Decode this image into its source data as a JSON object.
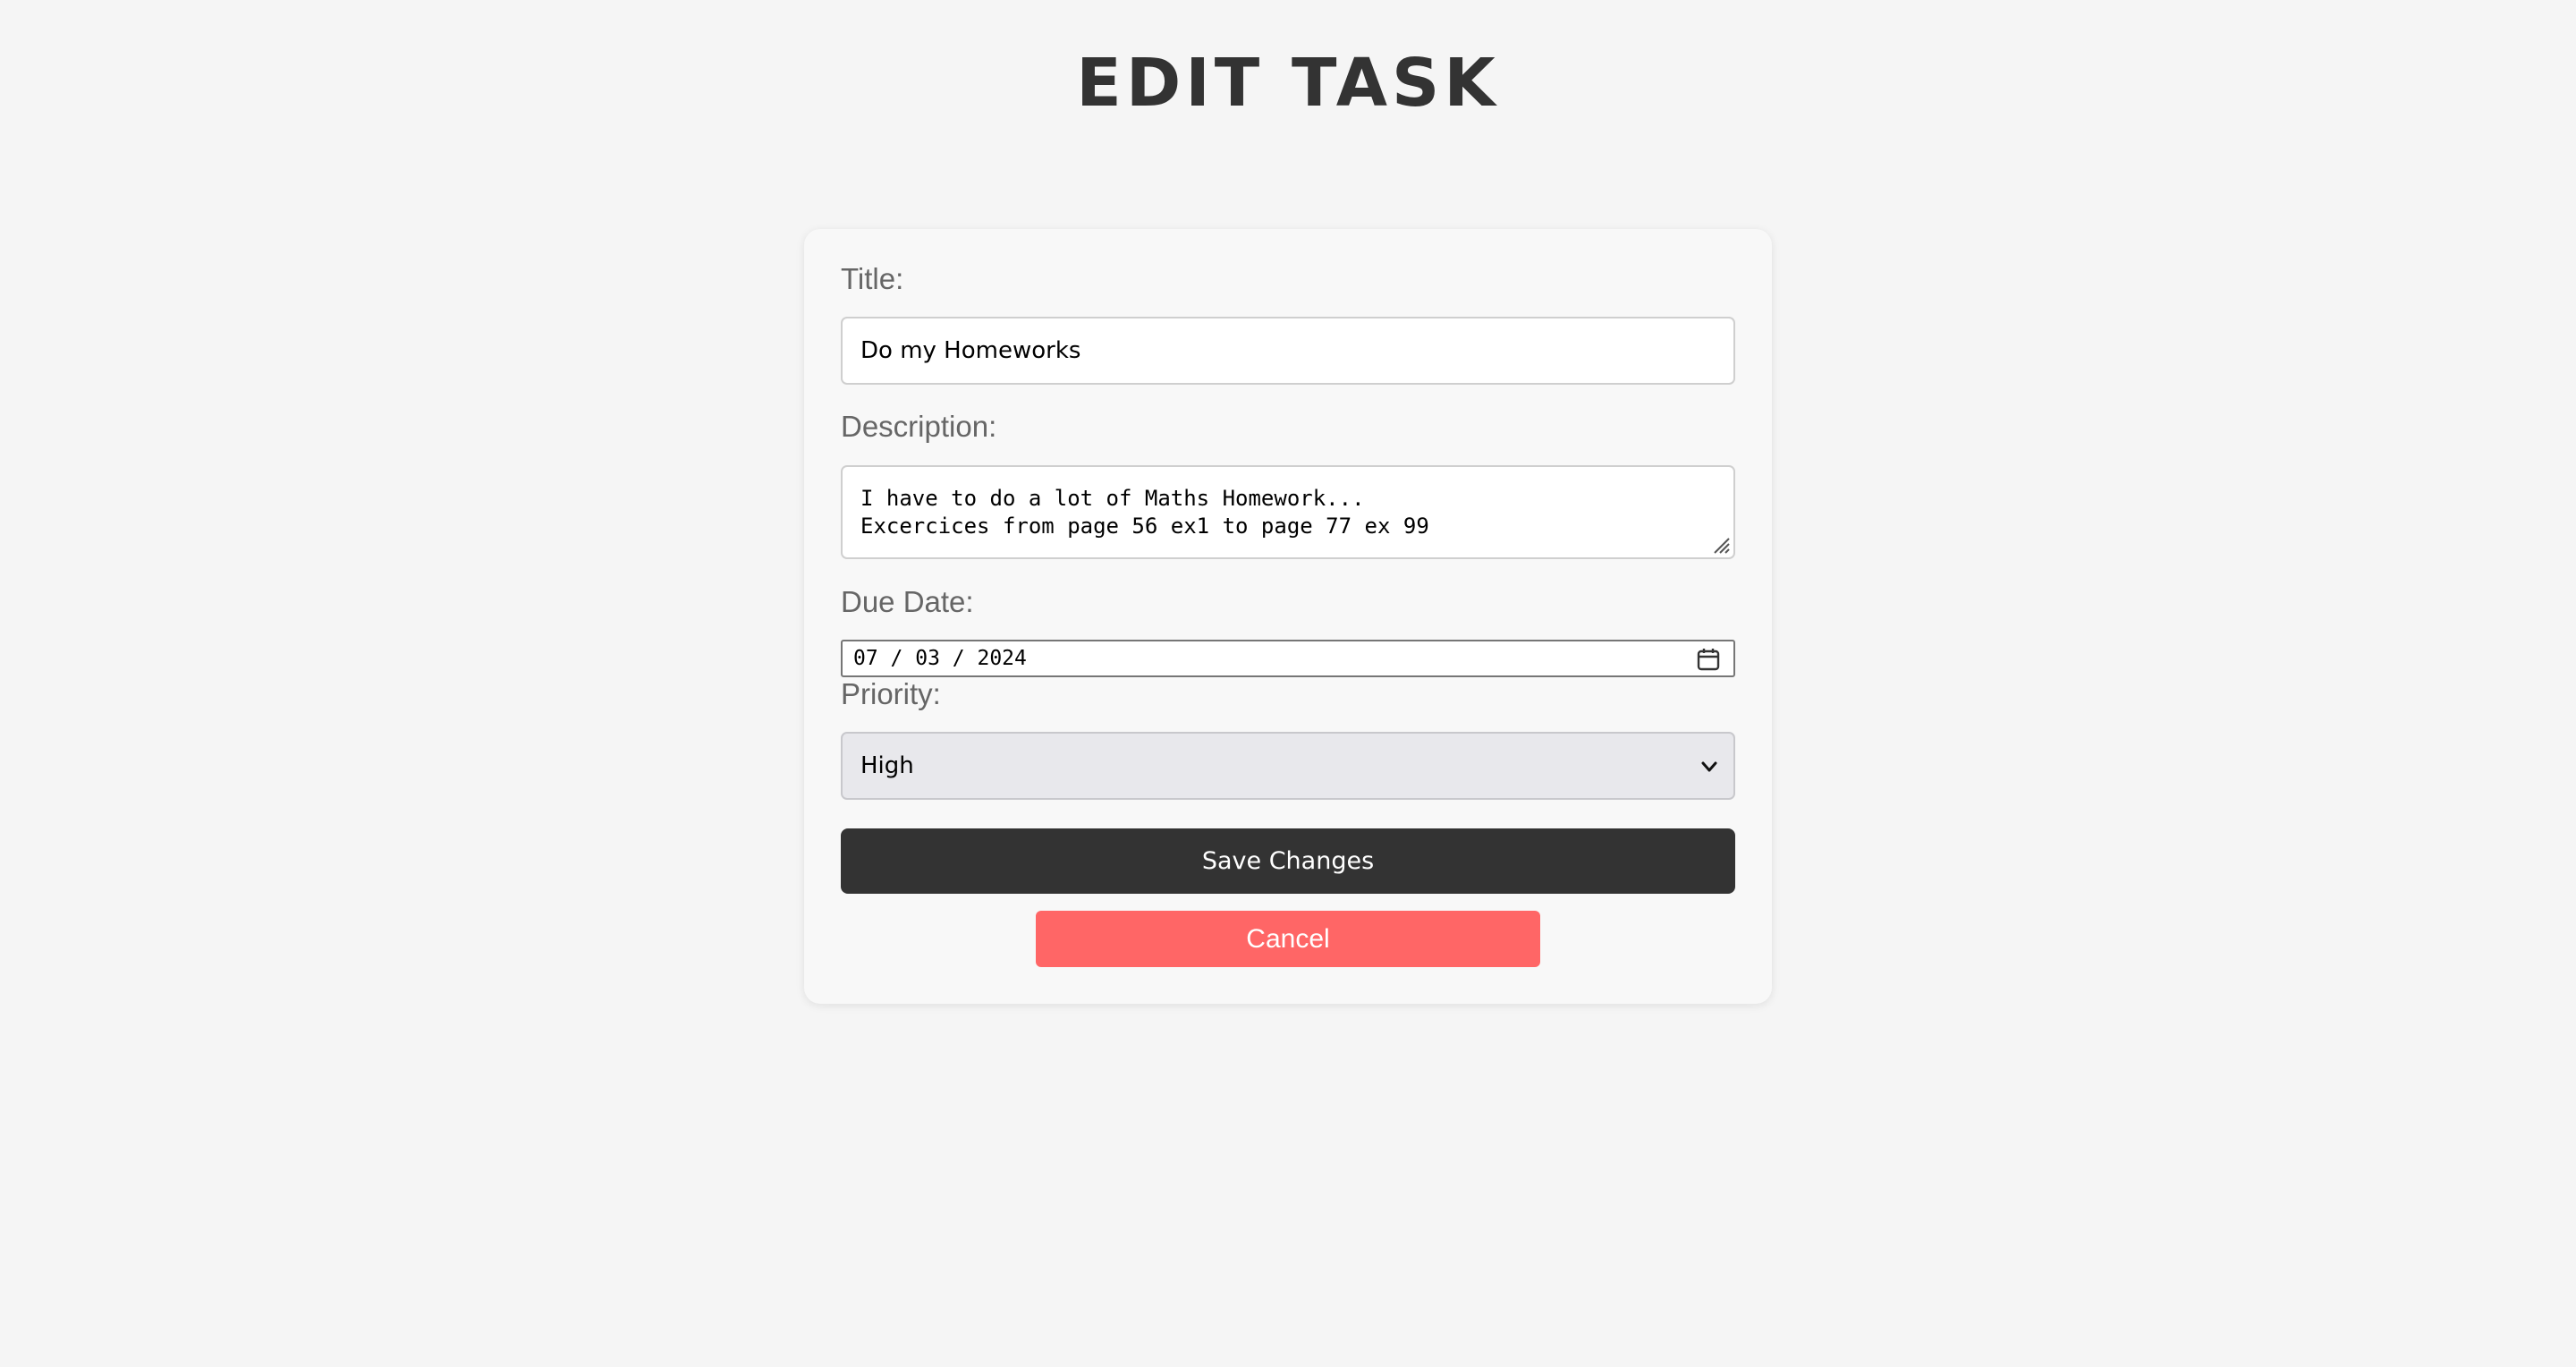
{
  "header": {
    "title": "EDIT TASK"
  },
  "form": {
    "title_label": "Title:",
    "title_value": "Do my Homeworks",
    "description_label": "Description:",
    "description_value": "I have to do a lot of Maths Homework...\nExcercices from page 56 ex1 to page 77 ex 99",
    "due_date_label": "Due Date:",
    "due_date_value": "07 / 03 / 2024",
    "priority_label": "Priority:",
    "priority_value": "High",
    "save_label": "Save Changes",
    "cancel_label": "Cancel"
  },
  "icons": {
    "calendar": "calendar-icon",
    "chevron": "chevron-down-icon",
    "resize": "resize-grip-icon"
  },
  "colors": {
    "background": "#f5f5f5",
    "card": "#f8f8f8",
    "title": "#333333",
    "save_button": "#333333",
    "cancel_button": "#ff6666",
    "select_background": "#e8e8ec"
  }
}
